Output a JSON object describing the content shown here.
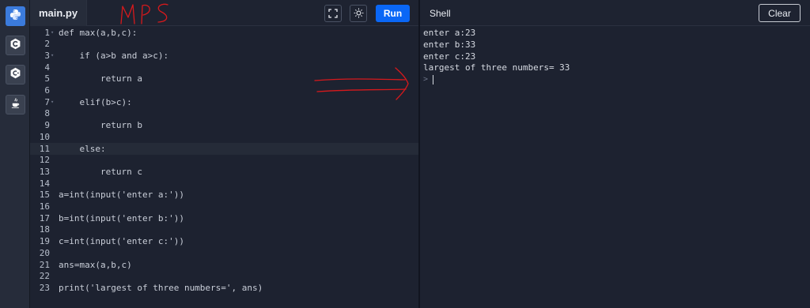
{
  "sidebar": {
    "items": [
      {
        "name": "python",
        "icon": "python-icon",
        "active": true
      },
      {
        "name": "c",
        "icon": "c-icon",
        "active": false
      },
      {
        "name": "cpp",
        "icon": "cpp-icon",
        "active": false
      },
      {
        "name": "java",
        "icon": "java-icon",
        "active": false
      }
    ]
  },
  "editor": {
    "tab_label": "main.py",
    "fullscreen_icon": "fullscreen-icon",
    "theme_icon": "sun-icon",
    "run_label": "Run",
    "current_line": 11,
    "lines": [
      {
        "n": "1",
        "text": "def max(a,b,c):"
      },
      {
        "n": "2",
        "text": ""
      },
      {
        "n": "3",
        "text": "    if (a>b and a>c):"
      },
      {
        "n": "4",
        "text": ""
      },
      {
        "n": "5",
        "text": "        return a"
      },
      {
        "n": "6",
        "text": ""
      },
      {
        "n": "7",
        "text": "    elif(b>c):"
      },
      {
        "n": "8",
        "text": ""
      },
      {
        "n": "9",
        "text": "        return b"
      },
      {
        "n": "10",
        "text": ""
      },
      {
        "n": "11",
        "text": "    else:"
      },
      {
        "n": "12",
        "text": ""
      },
      {
        "n": "13",
        "text": "        return c"
      },
      {
        "n": "14",
        "text": ""
      },
      {
        "n": "15",
        "text": "a=int(input('enter a:'))"
      },
      {
        "n": "16",
        "text": ""
      },
      {
        "n": "17",
        "text": "b=int(input('enter b:'))"
      },
      {
        "n": "18",
        "text": ""
      },
      {
        "n": "19",
        "text": "c=int(input('enter c:'))"
      },
      {
        "n": "20",
        "text": ""
      },
      {
        "n": "21",
        "text": "ans=max(a,b,c)"
      },
      {
        "n": "22",
        "text": ""
      },
      {
        "n": "23",
        "text": "print('largest of three numbers=', ans)"
      }
    ]
  },
  "shell": {
    "title": "Shell",
    "clear_label": "Clear",
    "output": [
      "enter a:23",
      "enter b:33",
      "enter c:23",
      "largest of three numbers= 33"
    ],
    "prompt": ">"
  },
  "annotation": {
    "handwritten_text": "MPS",
    "color": "#d7191c"
  },
  "colors": {
    "accent": "#0a67f6",
    "background": "#1d2230"
  }
}
